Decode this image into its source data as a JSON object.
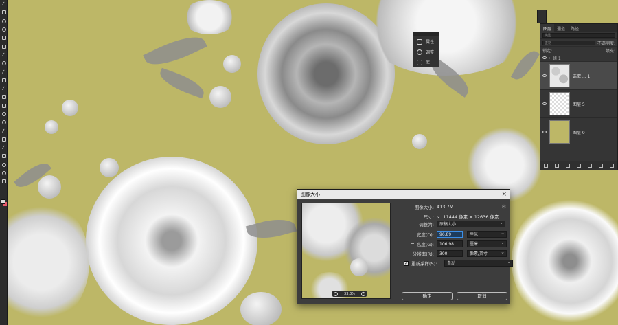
{
  "colors": {
    "canvas_bg": "#bdb767",
    "panel_bg": "#353535",
    "accent": "#3b8fe8"
  },
  "mini_panel": {
    "items": [
      {
        "label": "属性",
        "icon": "properties-icon"
      },
      {
        "label": "调整",
        "icon": "adjustments-icon"
      },
      {
        "label": "库",
        "icon": "libraries-icon"
      }
    ]
  },
  "layers_panel": {
    "tabs": [
      "图层",
      "通道",
      "路径"
    ],
    "search_placeholder": "类型",
    "blend_mode": "正常",
    "opacity_label": "不透明度:",
    "lock_label": "锁定:",
    "fill_label": "填充:",
    "group_name": "组 1",
    "layers": [
      {
        "name": "选取 ... 1",
        "thumb": "flor",
        "selected": true
      },
      {
        "name": "图层 5",
        "thumb": "trans",
        "selected": false
      },
      {
        "name": "图层 0",
        "thumb": "fill",
        "selected": false
      }
    ]
  },
  "dialog": {
    "title": "图像大小",
    "image_size_label": "图像大小:",
    "image_size_value": "413.7M",
    "dimensions_label": "尺寸:",
    "dimensions_value": "11444 像素 × 12636 像素",
    "fit_label": "调整为:",
    "fit_value": "原稿大小",
    "width_label": "宽度(D):",
    "width_value": "96.89",
    "width_unit": "厘米",
    "height_label": "高度(G):",
    "height_value": "106.98",
    "height_unit": "厘米",
    "resolution_label": "分辨率(R):",
    "resolution_value": "300",
    "resolution_unit": "像素/英寸",
    "resample_label": "重新采样(S):",
    "resample_value": "自动",
    "zoom_value": "33.3%",
    "ok_label": "确定",
    "cancel_label": "取消"
  }
}
